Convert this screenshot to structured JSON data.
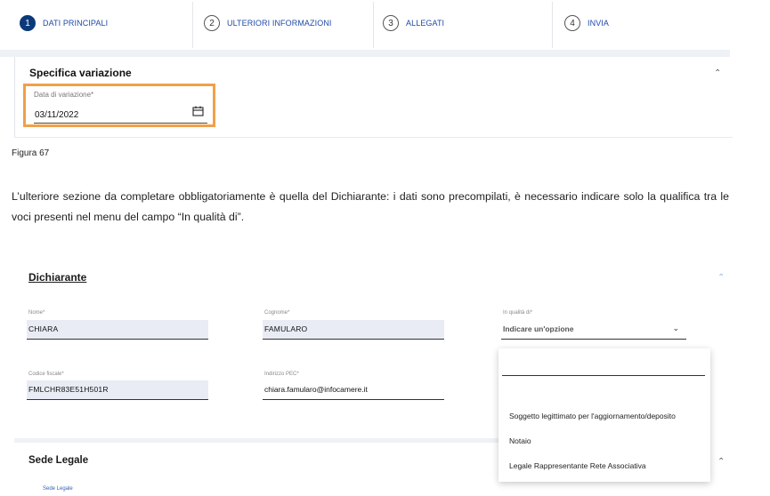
{
  "stepper": {
    "steps": [
      {
        "number": "1",
        "label": "DATI PRINCIPALI"
      },
      {
        "number": "2",
        "label": "ULTERIORI INFORMAZIONI"
      },
      {
        "number": "3",
        "label": "ALLEGATI"
      },
      {
        "number": "4",
        "label": "INVIA"
      }
    ]
  },
  "specifica": {
    "title": "Specifica variazione",
    "date_label": "Data di variazione*",
    "date_value": "03/11/2022"
  },
  "caption": "Figura 67",
  "paragraph": "L’ulteriore sezione da completare obbligatoriamente è quella del Dichiarante: i dati sono precompilati, è necessario indicare solo la qualifica tra le voci presenti nel menu del campo “In qualità di”.",
  "dichiarante": {
    "title": "Dichiarante",
    "nome_label": "Nome*",
    "nome_value": "CHIARA",
    "cognome_label": "Cognome*",
    "cognome_value": "FAMULARO",
    "qualita_label": "In qualità di*",
    "qualita_placeholder": "Indicare un'opzione",
    "cf_label": "Codice fiscale*",
    "cf_value": "FMLCHR83E51H501R",
    "pec_label": "Indirizzo PEC*",
    "pec_value": "chiara.famularo@infocamere.it",
    "options": [
      "Soggetto legittimato per l'aggiornamento/deposito",
      "Notaio",
      "Legale Rappresentante Rete Associativa"
    ]
  },
  "sede": {
    "title": "Sede Legale",
    "sub": "Sede Legale"
  },
  "colors": {
    "active_step": "#0b3a7a",
    "step_label": "#1f4aa8",
    "highlight": "#f0a04a"
  }
}
